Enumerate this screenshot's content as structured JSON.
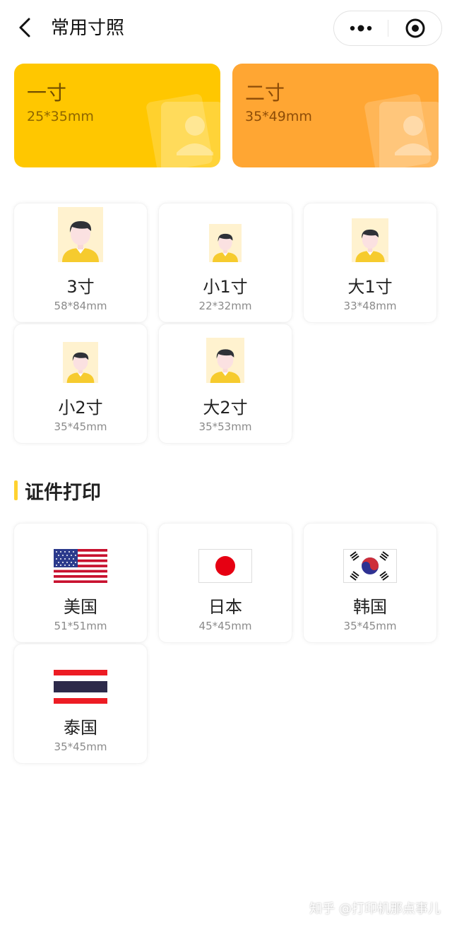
{
  "header": {
    "title": "常用寸照",
    "back_icon": "chevron-left-icon",
    "more_icon": "more-dots-icon",
    "close_icon": "target-icon"
  },
  "top_cards": [
    {
      "title": "一寸",
      "size": "25*35mm",
      "color": "#FFC700"
    },
    {
      "title": "二寸",
      "size": "35*49mm",
      "color": "#FFA633"
    }
  ],
  "size_cards": [
    {
      "name": "3寸",
      "dims": "58*84mm"
    },
    {
      "name": "小1寸",
      "dims": "22*32mm"
    },
    {
      "name": "大1寸",
      "dims": "33*48mm"
    },
    {
      "name": "小2寸",
      "dims": "35*45mm"
    },
    {
      "name": "大2寸",
      "dims": "35*53mm"
    }
  ],
  "section": {
    "title": "证件打印",
    "accent": "#FFD230"
  },
  "flag_cards": [
    {
      "name": "美国",
      "dims": "51*51mm",
      "icon": "us-flag-icon"
    },
    {
      "name": "日本",
      "dims": "45*45mm",
      "icon": "japan-flag-icon"
    },
    {
      "name": "韩国",
      "dims": "35*45mm",
      "icon": "korea-flag-icon"
    },
    {
      "name": "泰国",
      "dims": "35*45mm",
      "icon": "thailand-flag-icon"
    }
  ],
  "watermark": "知乎 @打印机那点事儿"
}
